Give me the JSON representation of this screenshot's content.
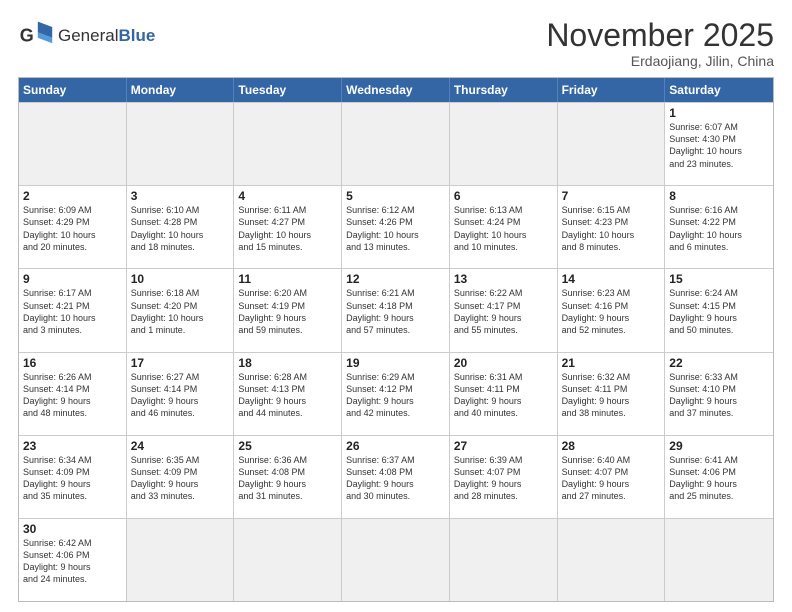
{
  "logo": {
    "text_general": "General",
    "text_blue": "Blue"
  },
  "title": "November 2025",
  "location": "Erdaojiang, Jilin, China",
  "days_of_week": [
    "Sunday",
    "Monday",
    "Tuesday",
    "Wednesday",
    "Thursday",
    "Friday",
    "Saturday"
  ],
  "weeks": [
    [
      {
        "day": "",
        "empty": true
      },
      {
        "day": "",
        "empty": true
      },
      {
        "day": "",
        "empty": true
      },
      {
        "day": "",
        "empty": true
      },
      {
        "day": "",
        "empty": true
      },
      {
        "day": "",
        "empty": true
      },
      {
        "day": "1",
        "info": "Sunrise: 6:07 AM\nSunset: 4:30 PM\nDaylight: 10 hours\nand 23 minutes."
      }
    ],
    [
      {
        "day": "2",
        "info": "Sunrise: 6:09 AM\nSunset: 4:29 PM\nDaylight: 10 hours\nand 20 minutes."
      },
      {
        "day": "3",
        "info": "Sunrise: 6:10 AM\nSunset: 4:28 PM\nDaylight: 10 hours\nand 18 minutes."
      },
      {
        "day": "4",
        "info": "Sunrise: 6:11 AM\nSunset: 4:27 PM\nDaylight: 10 hours\nand 15 minutes."
      },
      {
        "day": "5",
        "info": "Sunrise: 6:12 AM\nSunset: 4:26 PM\nDaylight: 10 hours\nand 13 minutes."
      },
      {
        "day": "6",
        "info": "Sunrise: 6:13 AM\nSunset: 4:24 PM\nDaylight: 10 hours\nand 10 minutes."
      },
      {
        "day": "7",
        "info": "Sunrise: 6:15 AM\nSunset: 4:23 PM\nDaylight: 10 hours\nand 8 minutes."
      },
      {
        "day": "8",
        "info": "Sunrise: 6:16 AM\nSunset: 4:22 PM\nDaylight: 10 hours\nand 6 minutes."
      }
    ],
    [
      {
        "day": "9",
        "info": "Sunrise: 6:17 AM\nSunset: 4:21 PM\nDaylight: 10 hours\nand 3 minutes."
      },
      {
        "day": "10",
        "info": "Sunrise: 6:18 AM\nSunset: 4:20 PM\nDaylight: 10 hours\nand 1 minute."
      },
      {
        "day": "11",
        "info": "Sunrise: 6:20 AM\nSunset: 4:19 PM\nDaylight: 9 hours\nand 59 minutes."
      },
      {
        "day": "12",
        "info": "Sunrise: 6:21 AM\nSunset: 4:18 PM\nDaylight: 9 hours\nand 57 minutes."
      },
      {
        "day": "13",
        "info": "Sunrise: 6:22 AM\nSunset: 4:17 PM\nDaylight: 9 hours\nand 55 minutes."
      },
      {
        "day": "14",
        "info": "Sunrise: 6:23 AM\nSunset: 4:16 PM\nDaylight: 9 hours\nand 52 minutes."
      },
      {
        "day": "15",
        "info": "Sunrise: 6:24 AM\nSunset: 4:15 PM\nDaylight: 9 hours\nand 50 minutes."
      }
    ],
    [
      {
        "day": "16",
        "info": "Sunrise: 6:26 AM\nSunset: 4:14 PM\nDaylight: 9 hours\nand 48 minutes."
      },
      {
        "day": "17",
        "info": "Sunrise: 6:27 AM\nSunset: 4:14 PM\nDaylight: 9 hours\nand 46 minutes."
      },
      {
        "day": "18",
        "info": "Sunrise: 6:28 AM\nSunset: 4:13 PM\nDaylight: 9 hours\nand 44 minutes."
      },
      {
        "day": "19",
        "info": "Sunrise: 6:29 AM\nSunset: 4:12 PM\nDaylight: 9 hours\nand 42 minutes."
      },
      {
        "day": "20",
        "info": "Sunrise: 6:31 AM\nSunset: 4:11 PM\nDaylight: 9 hours\nand 40 minutes."
      },
      {
        "day": "21",
        "info": "Sunrise: 6:32 AM\nSunset: 4:11 PM\nDaylight: 9 hours\nand 38 minutes."
      },
      {
        "day": "22",
        "info": "Sunrise: 6:33 AM\nSunset: 4:10 PM\nDaylight: 9 hours\nand 37 minutes."
      }
    ],
    [
      {
        "day": "23",
        "info": "Sunrise: 6:34 AM\nSunset: 4:09 PM\nDaylight: 9 hours\nand 35 minutes."
      },
      {
        "day": "24",
        "info": "Sunrise: 6:35 AM\nSunset: 4:09 PM\nDaylight: 9 hours\nand 33 minutes."
      },
      {
        "day": "25",
        "info": "Sunrise: 6:36 AM\nSunset: 4:08 PM\nDaylight: 9 hours\nand 31 minutes."
      },
      {
        "day": "26",
        "info": "Sunrise: 6:37 AM\nSunset: 4:08 PM\nDaylight: 9 hours\nand 30 minutes."
      },
      {
        "day": "27",
        "info": "Sunrise: 6:39 AM\nSunset: 4:07 PM\nDaylight: 9 hours\nand 28 minutes."
      },
      {
        "day": "28",
        "info": "Sunrise: 6:40 AM\nSunset: 4:07 PM\nDaylight: 9 hours\nand 27 minutes."
      },
      {
        "day": "29",
        "info": "Sunrise: 6:41 AM\nSunset: 4:06 PM\nDaylight: 9 hours\nand 25 minutes."
      }
    ],
    [
      {
        "day": "30",
        "info": "Sunrise: 6:42 AM\nSunset: 4:06 PM\nDaylight: 9 hours\nand 24 minutes."
      },
      {
        "day": "",
        "empty": true
      },
      {
        "day": "",
        "empty": true
      },
      {
        "day": "",
        "empty": true
      },
      {
        "day": "",
        "empty": true
      },
      {
        "day": "",
        "empty": true
      },
      {
        "day": "",
        "empty": true
      }
    ]
  ]
}
